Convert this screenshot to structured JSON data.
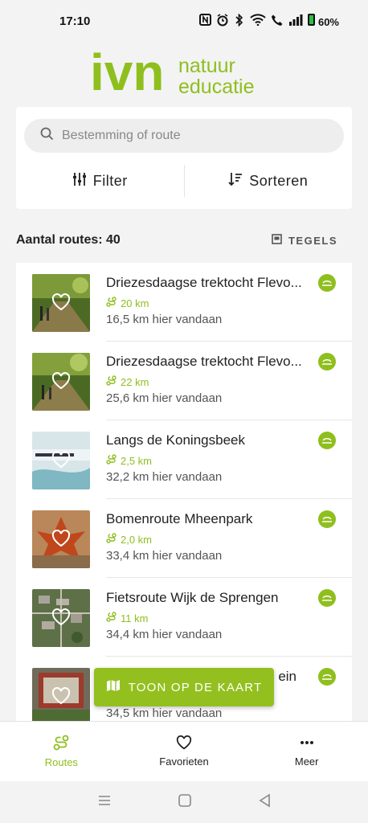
{
  "status": {
    "time": "17:10",
    "battery": "60%"
  },
  "brand": {
    "logo_text": "ivn",
    "tagline_1": "natuur",
    "tagline_2": "educatie",
    "color": "#8fbf1e"
  },
  "search": {
    "placeholder": "Bestemming of route"
  },
  "toolbar": {
    "filter_label": "Filter",
    "sort_label": "Sorteren"
  },
  "results": {
    "count_label": "Aantal routes: 40",
    "view_toggle_label": "TEGELS"
  },
  "routes": [
    {
      "title": "Driezesdaagse trektocht Flevo...",
      "length": "20 km",
      "distance": "16,5 km hier vandaan"
    },
    {
      "title": "Driezesdaagse trektocht Flevo...",
      "length": "22 km",
      "distance": "25,6 km hier vandaan"
    },
    {
      "title": "Langs de Koningsbeek",
      "length": "2,5 km",
      "distance": "32,2 km hier vandaan"
    },
    {
      "title": "Bomenroute Mheenpark",
      "length": "2,0 km",
      "distance": "33,4 km hier vandaan"
    },
    {
      "title": "Fietsroute Wijk de Sprengen",
      "length": "11 km",
      "distance": "34,4 km hier vandaan"
    },
    {
      "title": "ein",
      "length": "",
      "distance": "34,5 km hier vandaan"
    }
  ],
  "map_button": {
    "label": "TOON OP DE KAART"
  },
  "nav": {
    "routes": "Routes",
    "favorites": "Favorieten",
    "more": "Meer"
  },
  "icons": [
    "search-icon",
    "filter-icon",
    "sort-icon",
    "tiles-icon",
    "heart-icon",
    "route-icon",
    "ivn-badge-icon",
    "map-icon",
    "more-icon"
  ]
}
